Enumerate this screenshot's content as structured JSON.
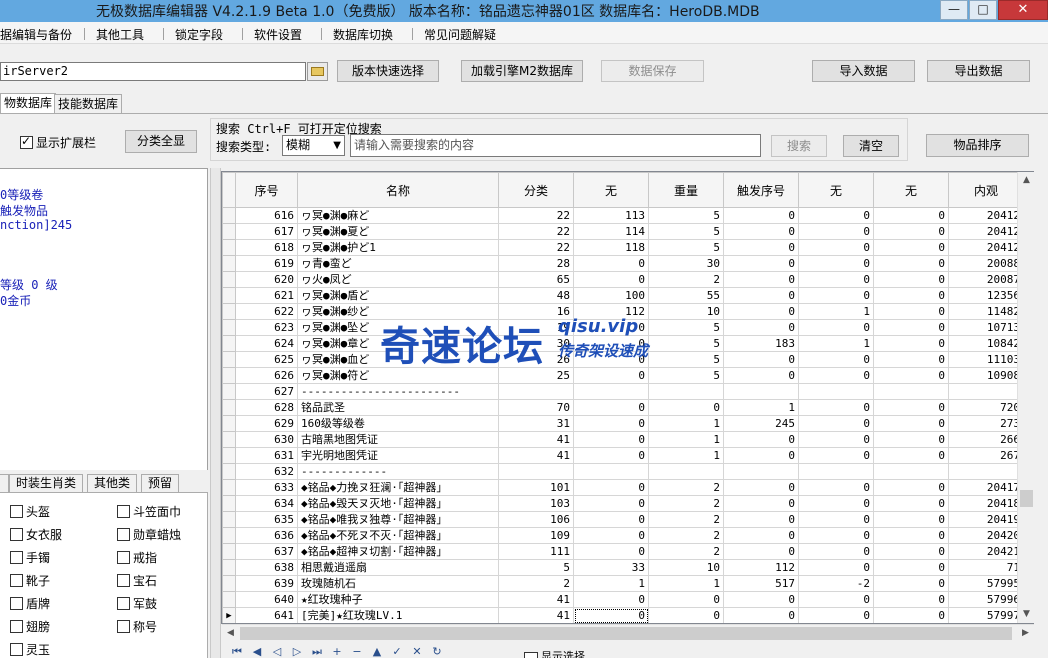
{
  "window": {
    "title": "无极数据库编辑器 V4.2.1.9   Beta 1.0（免费版）   版本名称：铭品遗忘神器01区   数据库名：HeroDB.MDB",
    "buttons": {
      "minimize": "—",
      "maximize": "□",
      "close": "✕"
    }
  },
  "menu": [
    "据编辑与备份",
    "其他工具",
    "锁定字段",
    "软件设置",
    "数据库切换",
    "常见问题解疑"
  ],
  "toolbar": {
    "server_value": "irServer2",
    "version_select": "版本快速选择",
    "load_m2": "加载引擎M2数据库",
    "save_data": "数据保存",
    "import": "导入数据",
    "export": "导出数据"
  },
  "tabs": [
    "物数据库",
    "技能数据库"
  ],
  "left": {
    "show_ext": "显示扩展栏",
    "cat_all": "分类全显",
    "info_lines": [
      "0等级卷",
      "触发物品",
      "nction]245",
      "等级 0 级",
      "0金币"
    ],
    "subtabs": [
      "",
      "时装生肖类",
      "其他类",
      "预留"
    ],
    "categories": [
      "头盔",
      "斗笠面巾",
      "女衣服",
      "勋章蜡烛",
      "手镯",
      "戒指",
      "靴子",
      "宝石",
      "盾牌",
      "军鼓",
      "翅膀",
      "称号",
      "灵玉"
    ]
  },
  "search": {
    "label": "搜索  Ctrl+F 可打开定位搜索",
    "type_label": "搜索类型:",
    "type_value": "模糊",
    "placeholder": "请输入需要搜索的内容",
    "search_btn": "搜索",
    "clear_btn": "清空",
    "sort_btn": "物品排序"
  },
  "grid": {
    "columns": [
      "序号",
      "名称",
      "分类",
      "无",
      "重量",
      "触发序号",
      "无",
      "无",
      "内观"
    ],
    "rows": [
      [
        "616",
        "ヮ冥●渊●麻ど",
        "22",
        "113",
        "5",
        "0",
        "0",
        "0",
        "20412"
      ],
      [
        "617",
        "ヮ冥●渊●夏ど",
        "22",
        "114",
        "5",
        "0",
        "0",
        "0",
        "20412"
      ],
      [
        "618",
        "ヮ冥●渊●护ど1",
        "22",
        "118",
        "5",
        "0",
        "0",
        "0",
        "20412"
      ],
      [
        "619",
        "ヮ青●蛮ど",
        "28",
        "0",
        "30",
        "0",
        "0",
        "0",
        "20088"
      ],
      [
        "620",
        "ヮ火●凤ど",
        "65",
        "0",
        "2",
        "0",
        "0",
        "0",
        "20087"
      ],
      [
        "621",
        "ヮ冥●渊●盾ど",
        "48",
        "100",
        "55",
        "0",
        "0",
        "0",
        "12356"
      ],
      [
        "622",
        "ヮ冥●渊●纱ど",
        "16",
        "112",
        "10",
        "0",
        "1",
        "0",
        "11482"
      ],
      [
        "623",
        "ヮ冥●渊●坠ど",
        "19",
        "0",
        "5",
        "0",
        "0",
        "0",
        "10713"
      ],
      [
        "624",
        "ヮ冥●渊●章ど",
        "30",
        "0",
        "5",
        "183",
        "1",
        "0",
        "10842"
      ],
      [
        "625",
        "ヮ冥●渊●血ど",
        "26",
        "0",
        "5",
        "0",
        "0",
        "0",
        "11103"
      ],
      [
        "626",
        "ヮ冥●渊●符ど",
        "25",
        "0",
        "5",
        "0",
        "0",
        "0",
        "10908"
      ],
      [
        "627",
        "------------------------",
        "",
        "",
        "",
        "",
        "",
        "",
        ""
      ],
      [
        "628",
        "铭品武圣",
        "70",
        "0",
        "0",
        "1",
        "0",
        "0",
        "720"
      ],
      [
        "629",
        "160级等级卷",
        "31",
        "0",
        "1",
        "245",
        "0",
        "0",
        "273"
      ],
      [
        "630",
        "古暗黑地图凭证",
        "41",
        "0",
        "1",
        "0",
        "0",
        "0",
        "266"
      ],
      [
        "631",
        "宇光明地图凭证",
        "41",
        "0",
        "1",
        "0",
        "0",
        "0",
        "267"
      ],
      [
        "632",
        "-------------",
        "",
        "",
        "",
        "",
        "",
        "",
        ""
      ],
      [
        "633",
        "◆铭品◆力挽ヌ狂澜·「超神器」",
        "101",
        "0",
        "2",
        "0",
        "0",
        "0",
        "20417"
      ],
      [
        "634",
        "◆铭品◆毁天ヌ灭地·「超神器」",
        "103",
        "0",
        "2",
        "0",
        "0",
        "0",
        "20418"
      ],
      [
        "635",
        "◆铭品◆唯我ヌ独尊·「超神器」",
        "106",
        "0",
        "2",
        "0",
        "0",
        "0",
        "20419"
      ],
      [
        "636",
        "◆铭品◆不死ヌ不灭·「超神器」",
        "109",
        "0",
        "2",
        "0",
        "0",
        "0",
        "20420"
      ],
      [
        "637",
        "◆铭品◆超神ヌ切割·「超神器」",
        "111",
        "0",
        "2",
        "0",
        "0",
        "0",
        "20421"
      ],
      [
        "638",
        "相思戴逍遥扇",
        "5",
        "33",
        "10",
        "112",
        "0",
        "0",
        "71"
      ],
      [
        "639",
        "玫瑰随机石",
        "2",
        "1",
        "1",
        "517",
        "-2",
        "0",
        "57995"
      ],
      [
        "640",
        "★红玫瑰种子",
        "41",
        "0",
        "0",
        "0",
        "0",
        "0",
        "57996"
      ],
      [
        "641",
        "[完美]★红玫瑰LV.1",
        "41",
        "0",
        "0",
        "0",
        "0",
        "0",
        "57997"
      ]
    ],
    "current_row_marker": "▶"
  },
  "bottom": {
    "nav_icons": [
      "first-icon",
      "prev-page-icon",
      "prev-icon",
      "next-icon",
      "last-icon",
      "add-icon",
      "delete-icon",
      "edit-icon",
      "confirm-icon",
      "cancel-icon",
      "refresh-icon"
    ],
    "checkbox_label": "显示选择"
  },
  "watermark": {
    "main": "奇速论坛",
    "url": "qisu.vip",
    "sub": "传奇架设速成"
  },
  "colors": {
    "titlebar": "#62a8e0",
    "info_text": "#1a22b8",
    "watermark": "#1f4fb8",
    "close": "#c7383a"
  }
}
